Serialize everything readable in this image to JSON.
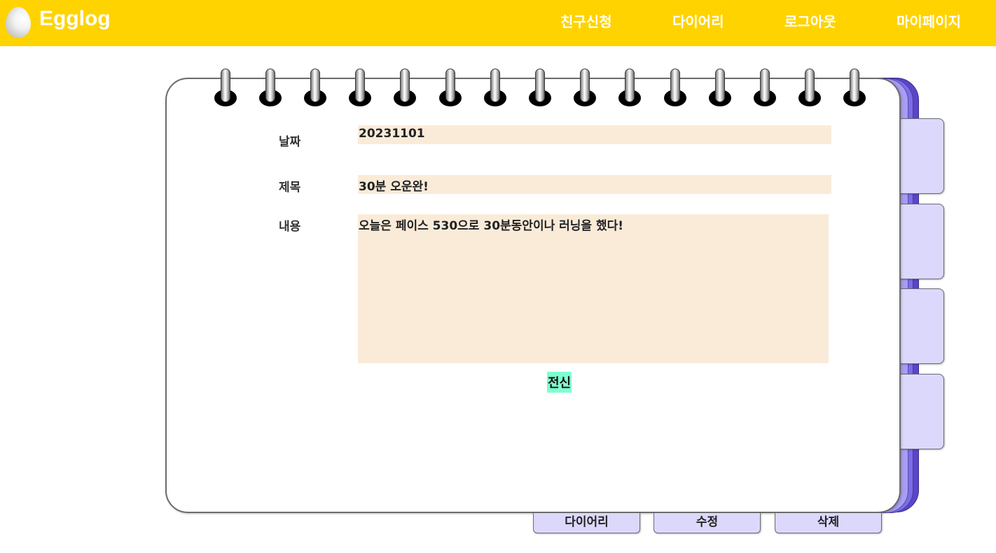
{
  "app": {
    "brand": "Egglog",
    "logo_icon": "egg-icon"
  },
  "nav": {
    "items": [
      {
        "label": "친구신청"
      },
      {
        "label": "다이어리"
      },
      {
        "label": "로그아웃"
      },
      {
        "label": "마이페이지"
      }
    ]
  },
  "diary": {
    "date_label": "날짜",
    "date_value": "20231101",
    "title_label": "제목",
    "title_value": "30분 오운완!",
    "content_label": "내용",
    "content_value": "오늘은 페이스 530으로 30분동안이나 러닝을 했다!",
    "tag": "전신"
  },
  "actions": {
    "diary_label": "다이어리",
    "edit_label": "수정",
    "delete_label": "삭제"
  },
  "colors": {
    "header": "#ffd300",
    "field_bg": "#faebd9",
    "tag_bg": "#7fffd0",
    "tab_bg": "#dcd8fc",
    "notebook_edge": "#7b6de6"
  }
}
